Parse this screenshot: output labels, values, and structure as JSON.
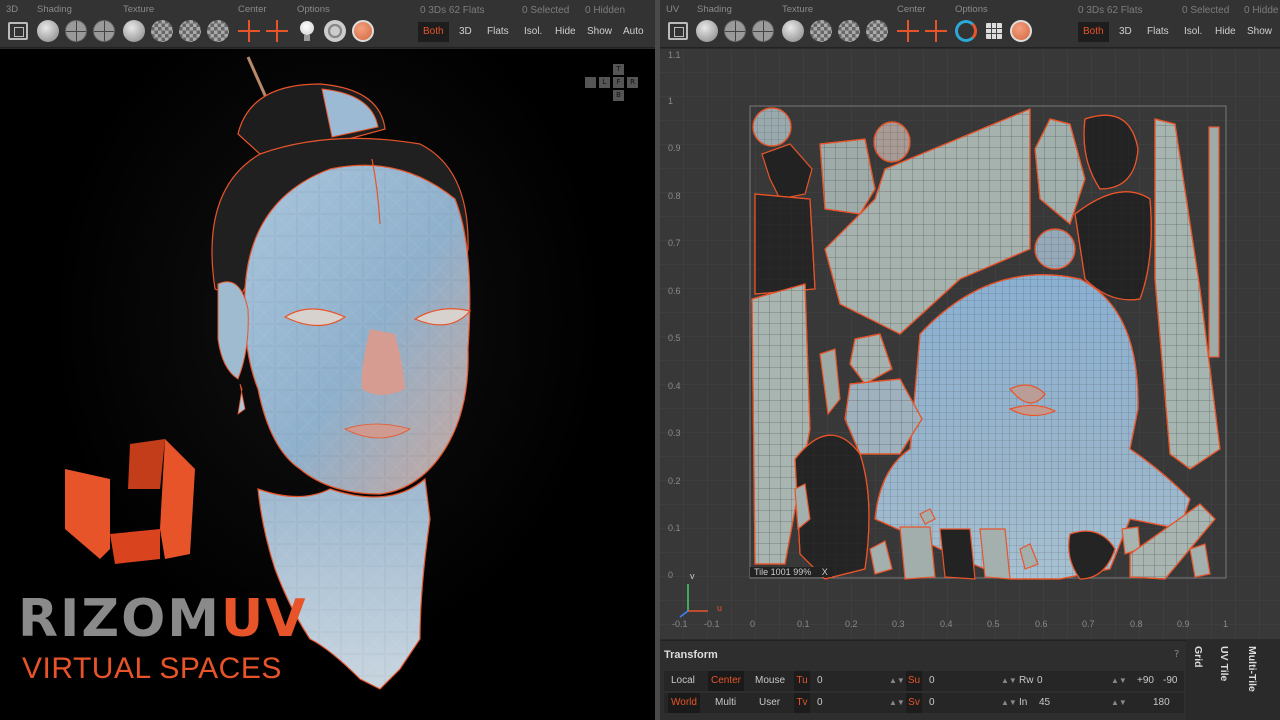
{
  "left_toolbar": {
    "groups": {
      "view": "3D",
      "shading": "Shading",
      "texture": "Texture",
      "center": "Center",
      "options": "Options"
    },
    "info": {
      "stats": "0 3Ds 62 Flats",
      "selected": "0 Selected",
      "hidden": "0 Hidden"
    },
    "modes": [
      "Both",
      "3D",
      "Flats",
      "Isol.",
      "Hide",
      "Show",
      "Auto"
    ],
    "active_mode": "Both"
  },
  "right_toolbar": {
    "groups": {
      "view": "UV",
      "shading": "Shading",
      "texture": "Texture",
      "center": "Center",
      "options": "Options"
    },
    "info": {
      "stats": "0 3Ds 62 Flats",
      "selected": "0 Selected",
      "hidden": "0 Hidde"
    },
    "modes": [
      "Both",
      "3D",
      "Flats",
      "Isol.",
      "Hide",
      "Show"
    ],
    "active_mode": "Both"
  },
  "navcube": {
    "top": "T",
    "left": "L",
    "front": "F",
    "right": "R",
    "bottom": "B"
  },
  "logo": {
    "name_gray": "RIZOM",
    "name_orange": "UV",
    "tagline": "VIRTUAL SPACES"
  },
  "uv_view": {
    "y_ticks": [
      "1.1",
      "1",
      "0.9",
      "0.8",
      "0.7",
      "0.6",
      "0.5",
      "0.4",
      "0.3",
      "0.2",
      "0.1",
      "0"
    ],
    "x_ticks": [
      "-0.1",
      "-0.1",
      "0",
      "0.1",
      "0.2",
      "0.3",
      "0.4",
      "0.5",
      "0.6",
      "0.7",
      "0.8",
      "0.9",
      "1"
    ],
    "tile_label": "Tile 1001 99%",
    "tile_close": "X",
    "axis_v": "v",
    "axis_u": "u"
  },
  "transform_panel": {
    "title": "Transform",
    "help": "?",
    "row1": {
      "local": "Local",
      "center": "Center",
      "mouse": "Mouse",
      "tu": "Tu",
      "tu_val": "0",
      "su": "Su",
      "su_val": "0",
      "rw": "Rw",
      "rw_val": "0",
      "plus90": "+90",
      "minus90": "-90"
    },
    "row2": {
      "world": "World",
      "multi": "Multi",
      "user": "User",
      "tv": "Tv",
      "tv_val": "0",
      "sv": "Sv",
      "sv_val": "0",
      "in": "In",
      "in_val": "45",
      "r180": "180"
    }
  },
  "side_tabs": [
    "Grid",
    "UV Tile",
    "Multi-Tile"
  ],
  "colors": {
    "accent": "#e8542a",
    "mesh_blue": "#8fb3cf",
    "mesh_skin": "#c89888",
    "hair": "#1e1e1e"
  }
}
